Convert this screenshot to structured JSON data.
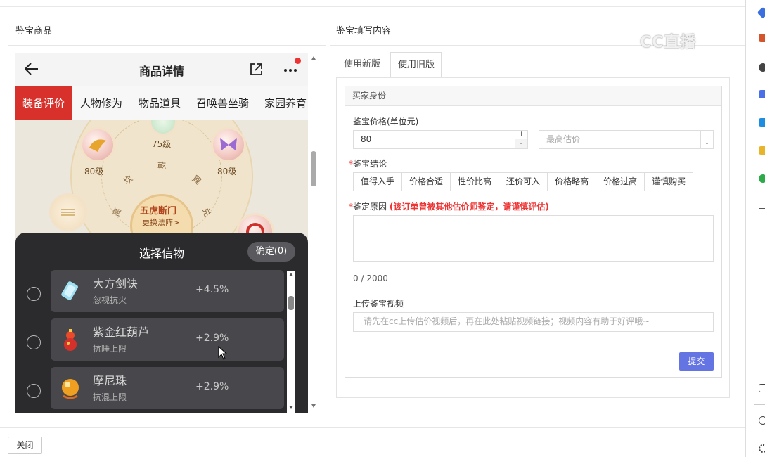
{
  "left_panel": {
    "title": "鉴宝商品"
  },
  "right_panel": {
    "title": "鉴宝填写内容"
  },
  "phone": {
    "header_title": "商品详情",
    "tabs": [
      "装备评价",
      "人物修为",
      "物品道具",
      "召唤兽坐骑",
      "家园养育"
    ],
    "board": {
      "center_title": "五虎断门",
      "center_sub": "更换法阵>",
      "levels": [
        "75级",
        "80级",
        "80级"
      ],
      "glyphs": [
        "乾",
        "巽",
        "坎",
        "兑",
        "离"
      ]
    },
    "overlay": {
      "title": "选择信物",
      "confirm": "确定(0)",
      "items": [
        {
          "name": "大方剑诀",
          "sub": "忽视抗火",
          "value": "+4.5%",
          "icon": "sword-scroll-icon"
        },
        {
          "name": "紫金红葫芦",
          "sub": "抗睡上限",
          "value": "+2.9%",
          "icon": "gourd-icon"
        },
        {
          "name": "摩尼珠",
          "sub": "抗混上限",
          "value": "+2.9%",
          "icon": "pearl-icon"
        }
      ]
    }
  },
  "form": {
    "tabs": [
      "使用新版",
      "使用旧版"
    ],
    "active_tab": "使用旧版",
    "card_title": "买家身份",
    "price_label": "鉴宝价格(单位元)",
    "price_value": "80",
    "max_placeholder": "最高估价",
    "conclusion_label": "鉴宝结论",
    "conclusion_options": [
      "值得入手",
      "价格合适",
      "性价比高",
      "还价可入",
      "价格略高",
      "价格过高",
      "谨慎购买"
    ],
    "reason_label": "鉴定原因",
    "reason_warning": "(该订单曾被其他估价师鉴定，请谨慎评估)",
    "char_count": "0 / 2000",
    "video_label": "上传鉴宝视频",
    "video_placeholder": "请先在cc上传估价视频后，再在此处粘贴视频链接；视频内容有助于好评哦~",
    "submit_label": "提交"
  },
  "footer": {
    "close_label": "关闭"
  },
  "watermark": "CC直播",
  "colors": {
    "accent": "#6574e3",
    "tab_red": "#d8302a",
    "warning": "#e33333",
    "overlay_bg": "#2b2b2e"
  }
}
